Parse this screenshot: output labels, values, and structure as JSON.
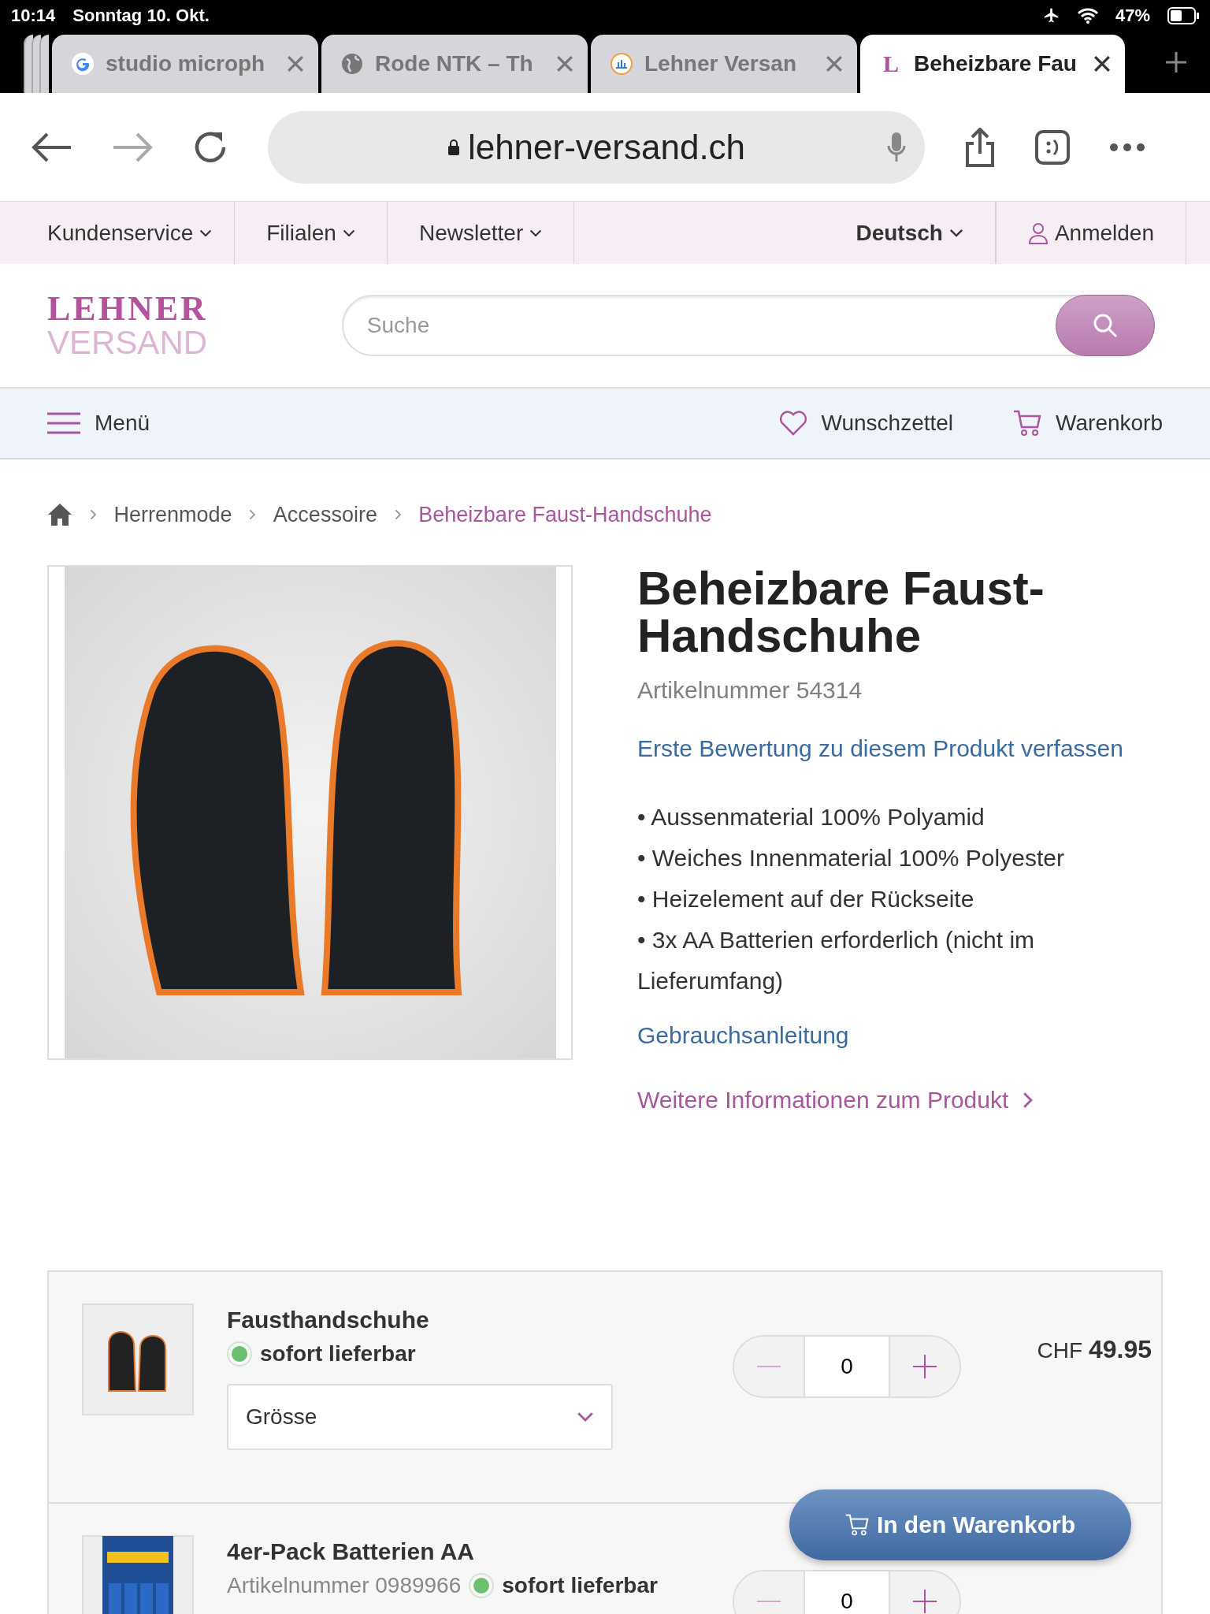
{
  "status_bar": {
    "time": "10:14",
    "date": "Sonntag 10. Okt.",
    "battery": "47%"
  },
  "browser": {
    "tabs": [
      {
        "title": "studio microph",
        "kind": "google",
        "selected": false
      },
      {
        "title": "Rode NTK – Th",
        "kind": "globe",
        "selected": false
      },
      {
        "title": "Lehner Versan",
        "kind": "site",
        "selected": false
      },
      {
        "title": "Beheizbare Fau",
        "kind": "letter",
        "favicon_text": "L",
        "selected": true
      }
    ],
    "url": "lehner-versand.ch"
  },
  "top_nav": [
    {
      "label": "Kundenservice",
      "kind": "dropdown"
    },
    {
      "label": "Filialen",
      "kind": "dropdown"
    },
    {
      "label": "Newsletter",
      "kind": "dropdown"
    },
    {
      "label": "Deutsch",
      "kind": "language"
    },
    {
      "label": "Anmelden",
      "kind": "account"
    }
  ],
  "logo": {
    "line1": "LEHNER",
    "line2": "VERSAND"
  },
  "search": {
    "placeholder": "Suche"
  },
  "menu_bar": {
    "menu": "Menü",
    "wishlist": "Wunschzettel",
    "cart": "Warenkorb"
  },
  "breadcrumb": [
    {
      "label": "Herrenmode",
      "current": false
    },
    {
      "label": "Accessoire",
      "current": false
    },
    {
      "label": "Beheizbare Faust-Handschuhe",
      "current": true
    }
  ],
  "product": {
    "title": "Beheizbare Faust-Handschuhe",
    "article": "Artikelnummer 54314",
    "review_link": "Erste Bewertung zu diesem Produkt verfassen",
    "features": [
      "• Aussenmaterial 100% Polyamid",
      "• Weiches Innenmaterial 100% Polyester",
      "• Heizelement auf der Rückseite",
      "• 3x AA Batterien erforderlich (nicht im Lieferumfang)"
    ],
    "manual_link": "Gebrauchsanleitung",
    "more_info_link": "Weitere Informationen zum Produkt"
  },
  "variants": [
    {
      "name": "Fausthandschuhe",
      "availability": "sofort lieferbar",
      "available": true,
      "select": "Grösse",
      "quantity": "0",
      "price": "CHF **49.95**"
    },
    {
      "name": "4er-Pack Batterien AA",
      "article": "Artikelnummer 0989966",
      "availability": "sofort lieferbar",
      "available": true,
      "quantity": "0"
    }
  ],
  "cart_button": "In den Warenkorb"
}
